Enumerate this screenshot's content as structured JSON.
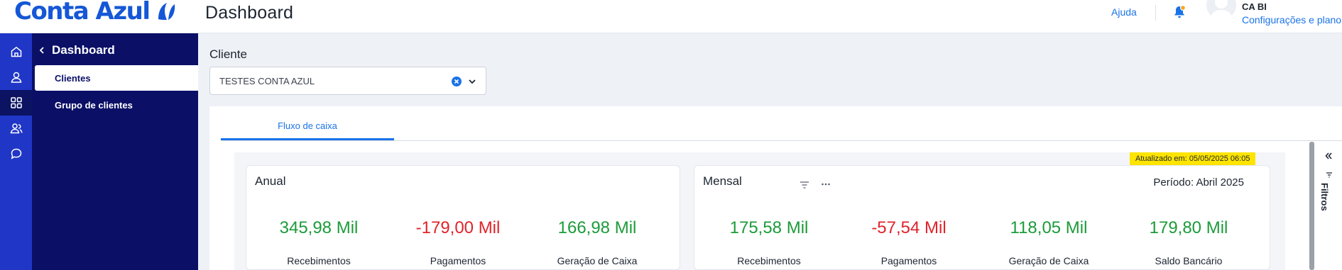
{
  "header": {
    "brand": "Conta Azul",
    "page_title": "Dashboard",
    "help": "Ajuda",
    "user_name": "CA BI",
    "user_link": "Configurações e plano",
    "accent": "#1a73e8",
    "brand_color": "#1557d6"
  },
  "rail": {
    "icons": [
      "home-icon",
      "user-icon",
      "grid-icon",
      "users-icon",
      "chat-icon"
    ],
    "active_index": 2,
    "color": "#1f36c7"
  },
  "sidebar": {
    "back_title": "Dashboard",
    "items": [
      {
        "label": "Clientes",
        "active": true
      },
      {
        "label": "Grupo de clientes",
        "active": false
      }
    ],
    "color": "#0b1066"
  },
  "filter": {
    "label": "Cliente",
    "value": "TESTES CONTA AZUL"
  },
  "tabs": [
    {
      "label": "Fluxo de caixa",
      "active": true
    }
  ],
  "updated_badge": "Atualizado em: 05/05/2025 06:05",
  "cards": {
    "anual": {
      "title": "Anual",
      "metrics": [
        {
          "value": "345,98 Mil",
          "label": "Recebimentos"
        },
        {
          "value": "-179,00 Mil",
          "label": "Pagamentos"
        },
        {
          "value": "166,98 Mil",
          "label": "Geração de Caixa"
        }
      ]
    },
    "mensal": {
      "title": "Mensal",
      "period": "Período: Abril 2025",
      "metrics": [
        {
          "value": "175,58 Mil",
          "label": "Recebimentos"
        },
        {
          "value": "-57,54 Mil",
          "label": "Pagamentos"
        },
        {
          "value": "118,05 Mil",
          "label": "Geração de Caixa"
        },
        {
          "value": "179,80 Mil",
          "label": "Saldo Bancário"
        }
      ]
    }
  },
  "status_colors": {
    "positive": "#1c9b3a",
    "negative": "#e0232a",
    "highlight": "#ffe400"
  },
  "side_panel": {
    "label": "Filtros"
  }
}
